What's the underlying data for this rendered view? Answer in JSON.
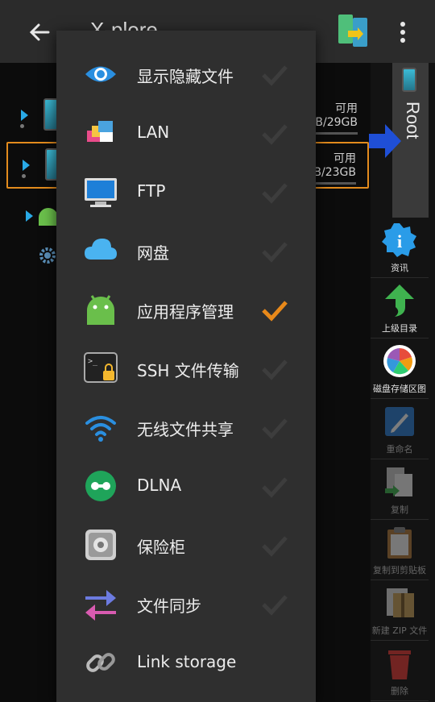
{
  "appbar": {
    "title": "X-plore",
    "back_icon": "arrow-left-icon",
    "more_icon": "more-vert-icon"
  },
  "tree": {
    "rows": [
      {
        "avail_label": "可用",
        "size_text": "3B/29GB"
      },
      {
        "avail_label": "可用",
        "size_text": "3B/23GB"
      }
    ]
  },
  "root_label": "Root",
  "tools": [
    {
      "label": "资讯",
      "icon": "info-icon",
      "enabled": true
    },
    {
      "label": "上级目录",
      "icon": "up-arrow-icon",
      "enabled": true
    },
    {
      "label": "磁盘存储区图",
      "icon": "pie-chart-icon",
      "enabled": true
    },
    {
      "label": "重命名",
      "icon": "rename-icon",
      "enabled": false
    },
    {
      "label": "复制",
      "icon": "copy-icon",
      "enabled": false
    },
    {
      "label": "复制到剪贴板",
      "icon": "clipboard-icon",
      "enabled": false
    },
    {
      "label": "新建 ZIP 文件",
      "icon": "zip-icon",
      "enabled": false
    },
    {
      "label": "删除",
      "icon": "trash-icon",
      "enabled": false
    }
  ],
  "menu": {
    "items": [
      {
        "label": "显示隐藏文件",
        "icon": "eye-icon",
        "checked": false
      },
      {
        "label": "LAN",
        "icon": "lan-icon",
        "checked": false
      },
      {
        "label": "FTP",
        "icon": "ftp-monitor-icon",
        "checked": false
      },
      {
        "label": "网盘",
        "icon": "cloud-icon",
        "checked": false
      },
      {
        "label": "应用程序管理",
        "icon": "android-icon",
        "checked": true
      },
      {
        "label": "SSH 文件传输",
        "icon": "ssh-terminal-lock-icon",
        "checked": false
      },
      {
        "label": "无线文件共享",
        "icon": "wifi-icon",
        "checked": false
      },
      {
        "label": "DLNA",
        "icon": "dlna-icon",
        "checked": false
      },
      {
        "label": "保险柜",
        "icon": "vault-icon",
        "checked": false
      },
      {
        "label": "文件同步",
        "icon": "sync-arrows-icon",
        "checked": false
      },
      {
        "label": "Link storage",
        "icon": "link-icon",
        "checked": false
      }
    ]
  },
  "colors": {
    "check_on": "#e8891a",
    "check_off": "#3d3d3d",
    "selection": "#e38b1d",
    "accent_blue": "#29a9e6"
  }
}
